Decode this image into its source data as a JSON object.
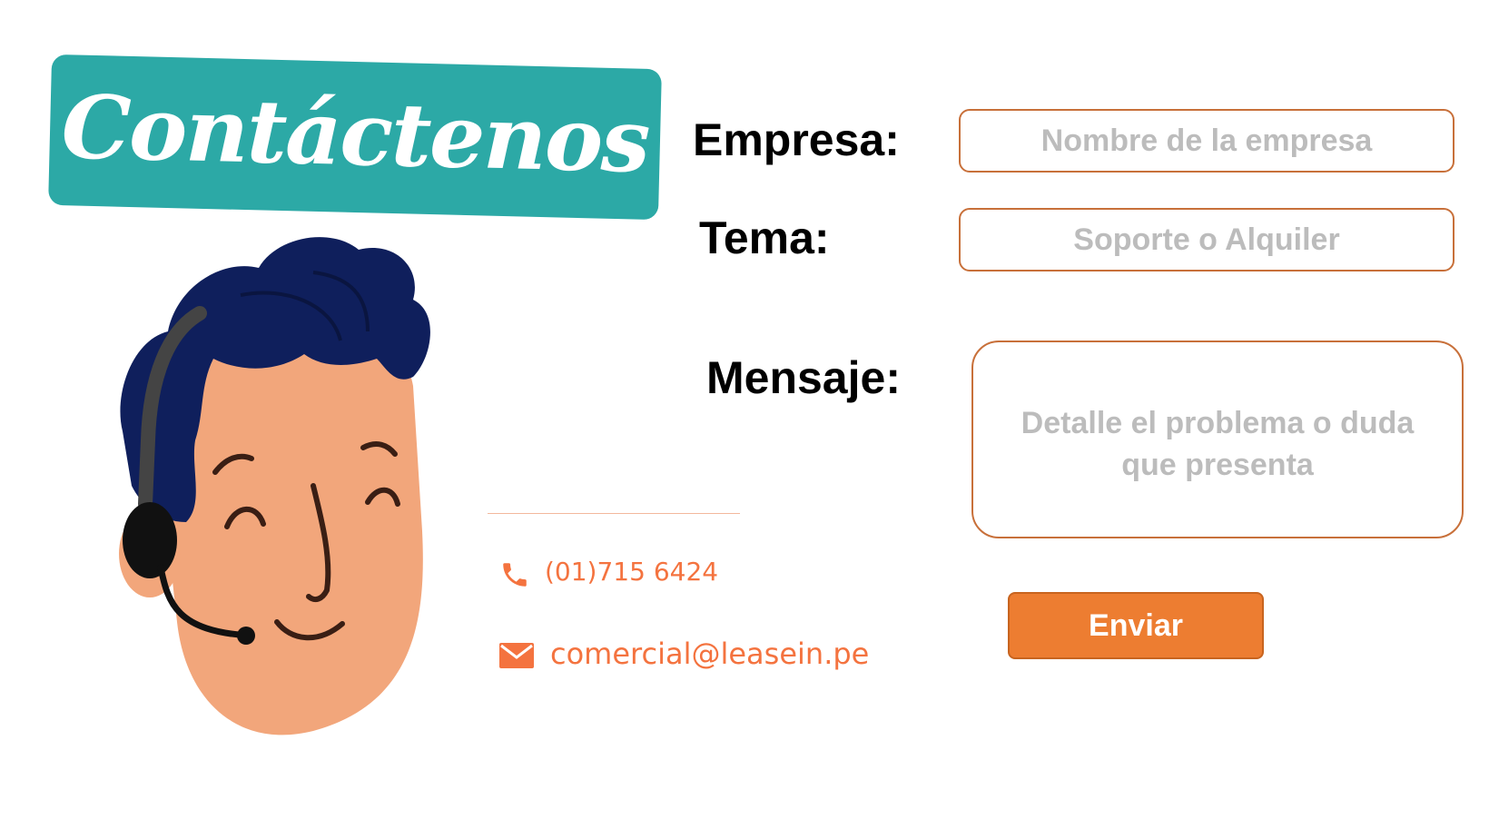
{
  "banner": {
    "title": "Contáctenos"
  },
  "form": {
    "company_label": "Empresa:",
    "company_placeholder": "Nombre de la empresa",
    "topic_label": "Tema:",
    "topic_placeholder": "Soporte o Alquiler",
    "message_label": "Mensaje:",
    "message_placeholder": "Detalle el problema o duda que presenta",
    "submit_label": "Enviar"
  },
  "contact": {
    "phone": "(01)715 6424",
    "email": "comercial@leasein.pe",
    "phone_icon": "phone-icon",
    "email_icon": "envelope-icon"
  },
  "colors": {
    "banner": "#2ca9a6",
    "accent": "#ed7d31",
    "field_border": "#c8703a",
    "contact_text": "#f4733f",
    "hair": "#0f1f5c",
    "skin": "#f2a67b"
  }
}
